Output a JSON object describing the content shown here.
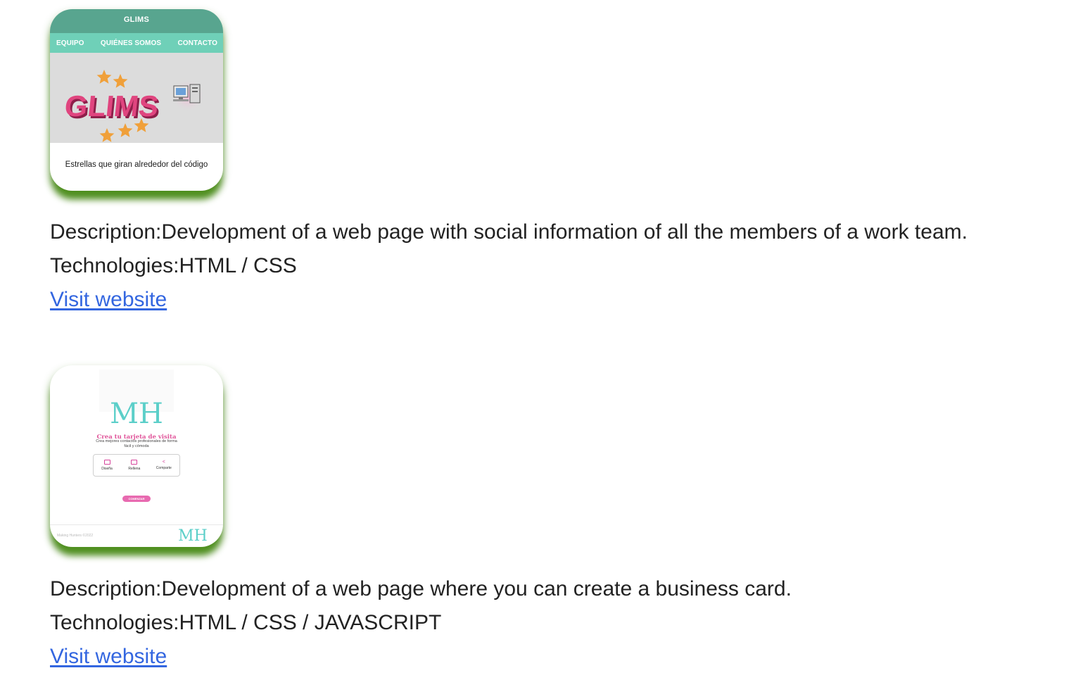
{
  "projects": [
    {
      "thumbnail": {
        "site_title": "GLIMS",
        "nav": [
          "EQUIPO",
          "QUIÉNES SOMOS",
          "CONTACTO"
        ],
        "logo_text": "GLIMS",
        "caption": "Estrellas que giran alrededor del código"
      },
      "description_label": "Description:",
      "description": "Development of a web page with social information of all the members of a work team.",
      "technologies_label": "Technologies:",
      "technologies": "HTML / CSS",
      "link_label": "Visit website"
    },
    {
      "thumbnail": {
        "logo_text": "MH",
        "title": "Crea tu tarjeta de visita",
        "subtitle": "Crea mejores contactos profesionales de forma fácil y cómoda",
        "steps": [
          "Diseña",
          "Rellena",
          "Comparte"
        ],
        "button": "COMENZAR",
        "footer_copy": "Making Hunters ©2022",
        "footer_logo": "MH"
      },
      "description_label": "Description:",
      "description": "Development of a web page where you can create a business card.",
      "technologies_label": "Technologies:",
      "technologies": "HTML / CSS / JAVASCRIPT",
      "link_label": "Visit website"
    }
  ],
  "colors": {
    "link": "#3366e0",
    "text": "#222222",
    "card_shadow": "#4f8f1f",
    "glims_header": "#58a58f",
    "glims_nav": "#6fd0b8",
    "glims_logo": "#e0457f",
    "star": "#f0a03a",
    "mh_logo": "#5ccfc9",
    "mh_accent": "#e86ab0"
  }
}
